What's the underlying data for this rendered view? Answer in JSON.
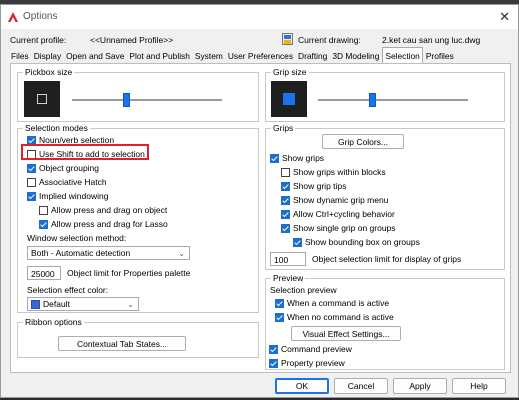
{
  "window": {
    "title": "Options",
    "close_icon": "✕"
  },
  "profile": {
    "current_profile_label": "Current profile:",
    "current_profile_value": "<<Unnamed Profile>>",
    "current_drawing_label": "Current drawing:",
    "current_drawing_value": "2.ket cau san ung luc.dwg"
  },
  "tabs": [
    {
      "label": "Files"
    },
    {
      "label": "Display"
    },
    {
      "label": "Open and Save"
    },
    {
      "label": "Plot and Publish"
    },
    {
      "label": "System"
    },
    {
      "label": "User Preferences"
    },
    {
      "label": "Drafting"
    },
    {
      "label": "3D Modeling"
    },
    {
      "label": "Selection"
    },
    {
      "label": "Profiles"
    }
  ],
  "active_tab": "Selection",
  "pickbox": {
    "title": "Pickbox size",
    "level": 0.5
  },
  "grip_size": {
    "title": "Grip size",
    "level": 0.5
  },
  "selection_modes": {
    "title": "Selection modes",
    "options": [
      {
        "label": "Noun/verb selection",
        "checked": true
      },
      {
        "label": "Use Shift to add to selection",
        "checked": false
      },
      {
        "label": "Object grouping",
        "checked": true
      },
      {
        "label": "Associative Hatch",
        "checked": false
      },
      {
        "label": "Implied windowing",
        "checked": true
      },
      {
        "label": "Allow press and drag on object",
        "checked": false
      },
      {
        "label": "Allow press and drag for Lasso",
        "checked": true
      }
    ],
    "window_method_label": "Window selection method:",
    "window_method_value": "Both - Automatic detection",
    "object_limit_value": "25000",
    "object_limit_label": "Object limit for Properties palette",
    "effect_color_label": "Selection effect color:",
    "effect_color_value": "Default"
  },
  "ribbon": {
    "title": "Ribbon options",
    "contextual_button": "Contextual Tab States..."
  },
  "grips": {
    "title": "Grips",
    "colors_button": "Grip Colors...",
    "options": [
      {
        "label": "Show grips",
        "checked": true
      },
      {
        "label": "Show grips within blocks",
        "checked": false
      },
      {
        "label": "Show grip tips",
        "checked": true
      },
      {
        "label": "Show dynamic grip menu",
        "checked": true
      },
      {
        "label": "Allow Ctrl+cycling behavior",
        "checked": true
      },
      {
        "label": "Show single grip on groups",
        "checked": true
      },
      {
        "label": "Show bounding box on groups",
        "checked": true
      }
    ],
    "limit_value": "100",
    "limit_label": "Object selection limit for display of grips"
  },
  "preview": {
    "title": "Preview",
    "selection_preview_label": "Selection preview",
    "options": [
      {
        "label": "When a command is active",
        "checked": true
      },
      {
        "label": "When no command is active",
        "checked": true
      }
    ],
    "visual_effect_button": "Visual Effect Settings...",
    "command_preview": {
      "label": "Command preview",
      "checked": true
    },
    "property_preview": {
      "label": "Property preview",
      "checked": true
    }
  },
  "footer": {
    "ok": "OK",
    "cancel": "Cancel",
    "apply": "Apply",
    "help": "Help"
  },
  "colors": {
    "accent": "#1a73e8",
    "highlight": "#e0202a",
    "preview_bg": "#1f1f1f"
  }
}
